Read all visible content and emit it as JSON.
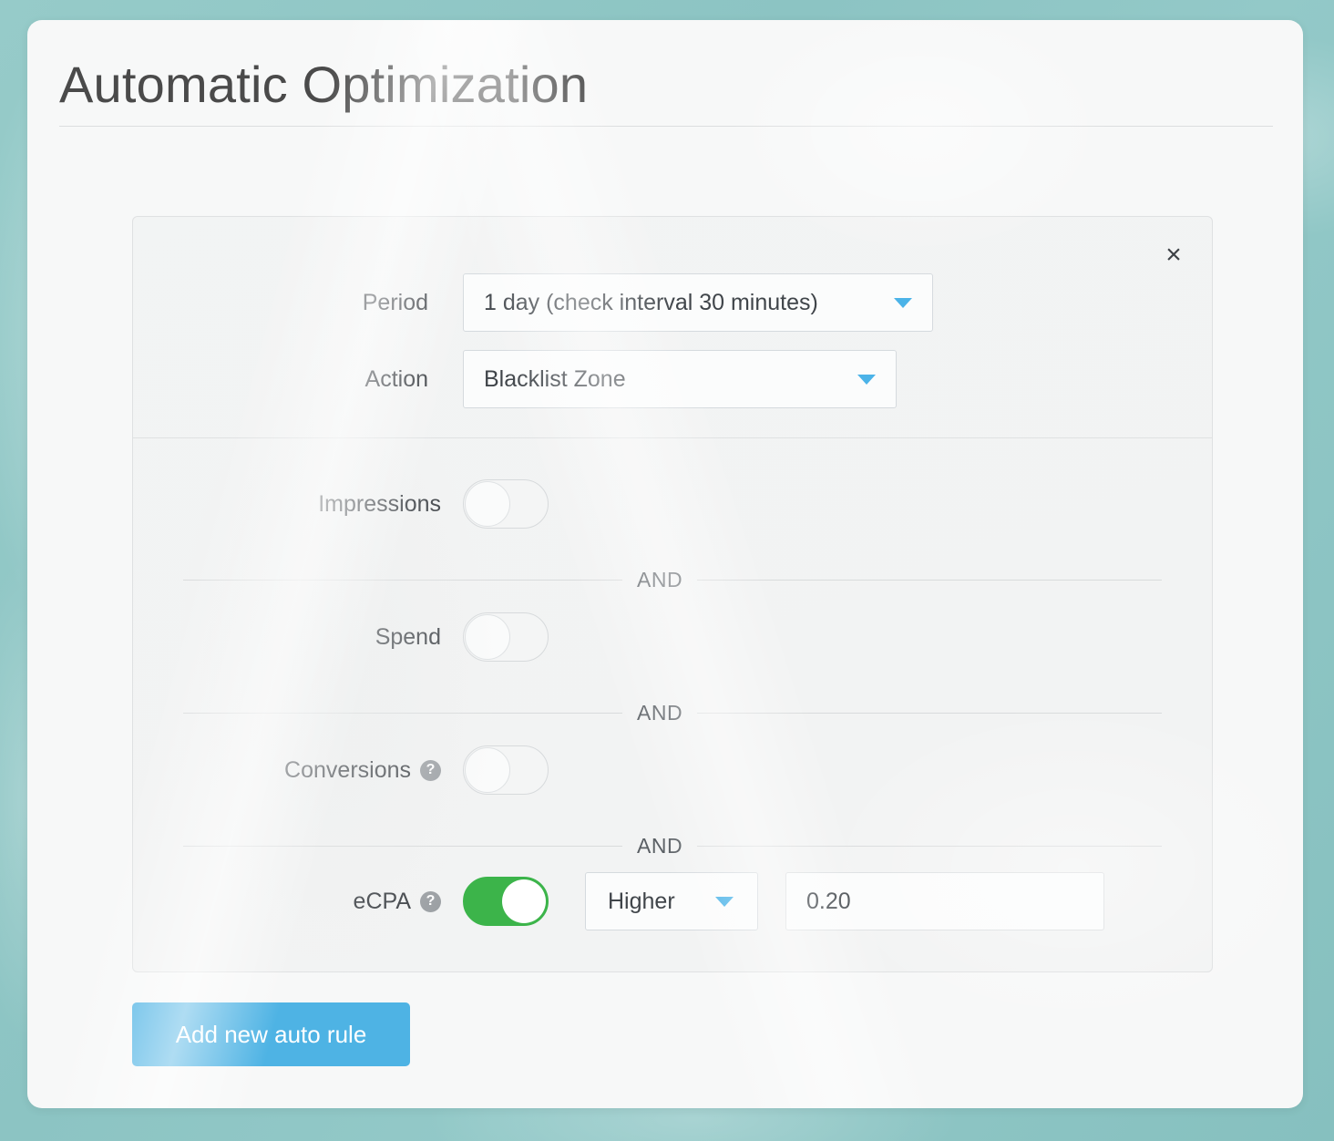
{
  "page": {
    "title": "Automatic Optimization",
    "background_color": "#8dc6c5",
    "card_color": "#f7f8f8"
  },
  "rule_panel": {
    "close_icon": "×",
    "fields": [
      {
        "label": "Period",
        "value": "1 day (check interval 30 minutes)",
        "caret_color": "#4bb3e8"
      },
      {
        "label": "Action",
        "value": "Blacklist Zone",
        "caret_color": "#4bb3e8"
      }
    ],
    "conditions": [
      {
        "label": "Impressions",
        "has_help": false,
        "help_icon": "?",
        "enabled": false
      },
      {
        "label": "Spend",
        "has_help": false,
        "help_icon": "?",
        "enabled": false
      },
      {
        "label": "Conversions",
        "has_help": true,
        "help_icon": "?",
        "enabled": false
      },
      {
        "label": "eCPA",
        "has_help": true,
        "help_icon": "?",
        "enabled": true,
        "comparator": "Higher",
        "value": "0.20"
      }
    ],
    "separator_label": "AND",
    "toggle_on_color": "#3cb44a",
    "toggle_off_color": "#f4f5f5"
  },
  "actions": {
    "add_rule_label": "Add new auto rule",
    "add_rule_color": "#4eb3e4"
  }
}
